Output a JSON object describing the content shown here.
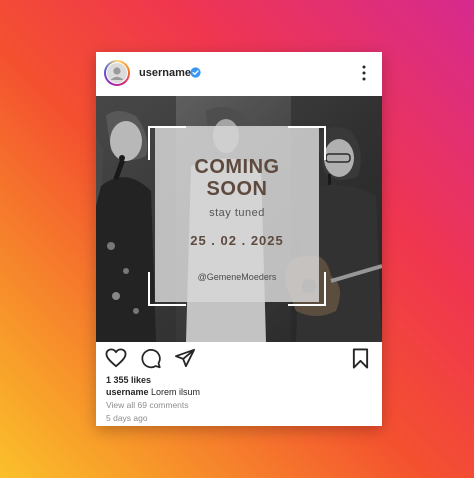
{
  "post": {
    "username": "username",
    "more_icon": "more-vertical-icon",
    "verified_icon": "verified-badge-icon",
    "image": {
      "heading": "COMING\nSOON",
      "tagline": "stay tuned",
      "date": "25 . 02 . 2025",
      "handle": "@GemeneMoeders"
    },
    "actions": [
      "heart-icon",
      "comment-icon",
      "share-icon",
      "bookmark-icon"
    ],
    "likes": "1 355 likes",
    "caption_user": "username",
    "caption_text": "Lorem ilsum",
    "comments_link": "View all 69 comments",
    "timestamp": "5 days ago"
  },
  "colors": {
    "background_gradient": [
      "#d62a8f",
      "#f0364f",
      "#f7942a",
      "#fbc02a"
    ],
    "heading_color": "#5e4a3f",
    "verified_blue": "#3897f0"
  }
}
